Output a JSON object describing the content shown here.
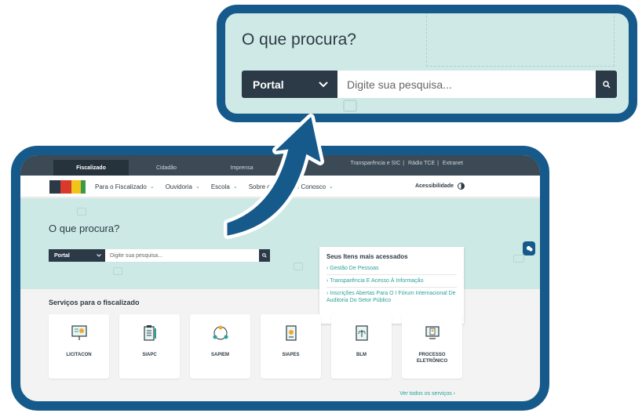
{
  "zoom": {
    "title": "O que procura?",
    "select_value": "Portal",
    "search_placeholder": "Digite sua pesquisa..."
  },
  "top_bar": {
    "tabs": [
      "Fiscalizado",
      "Cidadão",
      "Imprensa"
    ],
    "links": [
      "Transparência e SIC",
      "Rádio TCE",
      "Extranet"
    ]
  },
  "nav": {
    "items": [
      "Para o Fiscalizado",
      "Ouvidoria",
      "Escola",
      "Sobre o T",
      "Fale Conosco"
    ],
    "accessibility": "Acessibilidade"
  },
  "hero": {
    "title": "O que procura?",
    "select_value": "Portal",
    "search_placeholder": "Digite sua pesquisa..."
  },
  "popular": {
    "title": "Seus Itens mais acessados",
    "items": [
      "Gestão De Pessoas",
      "Transparência E Acesso À Informação",
      "Inscrições Abertas Para O I Fórum Internacional De Auditoria Do Setor Público"
    ]
  },
  "services": {
    "title": "Serviços para o fiscalizado",
    "cards": [
      {
        "label": "LICITACON",
        "icon": "presentation-icon"
      },
      {
        "label": "SIAPC",
        "icon": "clipboard-list-icon"
      },
      {
        "label": "SAPIEM",
        "icon": "people-network-icon"
      },
      {
        "label": "SIAPES",
        "icon": "badge-document-icon"
      },
      {
        "label": "BLM",
        "icon": "scale-document-icon"
      },
      {
        "label": "PROCESSO ELETRÔNICO",
        "icon": "monitor-document-icon"
      }
    ],
    "see_all": "Ver todos os serviços ›"
  },
  "colors": {
    "frame": "#155a8a",
    "dark": "#2b3a46",
    "accent": "#2aa198",
    "hero_bg": "#cce9e5"
  }
}
